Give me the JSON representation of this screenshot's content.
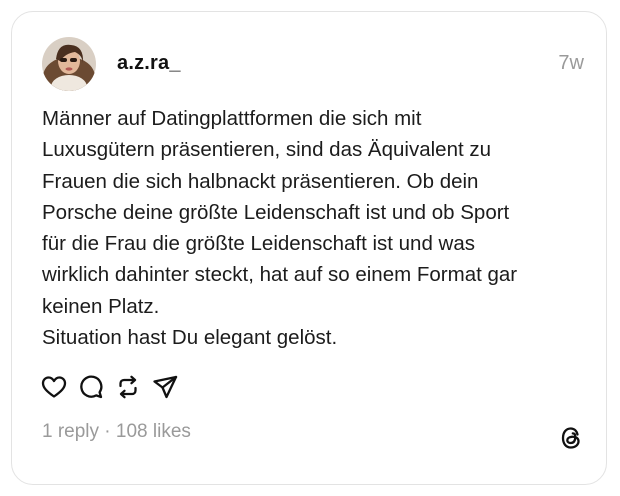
{
  "post": {
    "username": "a.z.ra_",
    "timestamp": "7w",
    "text": "Männer auf Datingplattformen die sich mit\nLuxusgütern präsentieren, sind das Äquivalent zu\nFrauen die sich halbnackt präsentieren. Ob dein\nPorsche deine größte Leidenschaft ist und ob Sport\nfür die Frau die größte Leidenschaft ist und was\nwirklich dahinter steckt, hat auf so einem Format gar\nkeinen Platz.\nSituation hast Du elegant gelöst.",
    "replies": "1 reply",
    "separator": " · ",
    "likes": "108 likes"
  },
  "actions": [
    {
      "name": "like",
      "icon": "heart-icon"
    },
    {
      "name": "reply",
      "icon": "speech-bubble-icon"
    },
    {
      "name": "repost",
      "icon": "repost-icon"
    },
    {
      "name": "share",
      "icon": "send-icon"
    }
  ],
  "logo": {
    "icon": "threads-logo-icon"
  },
  "colors": {
    "text": "#1c1c1c",
    "muted": "#9a9a9a",
    "border": "#e3e3e3",
    "background": "#ffffff"
  }
}
